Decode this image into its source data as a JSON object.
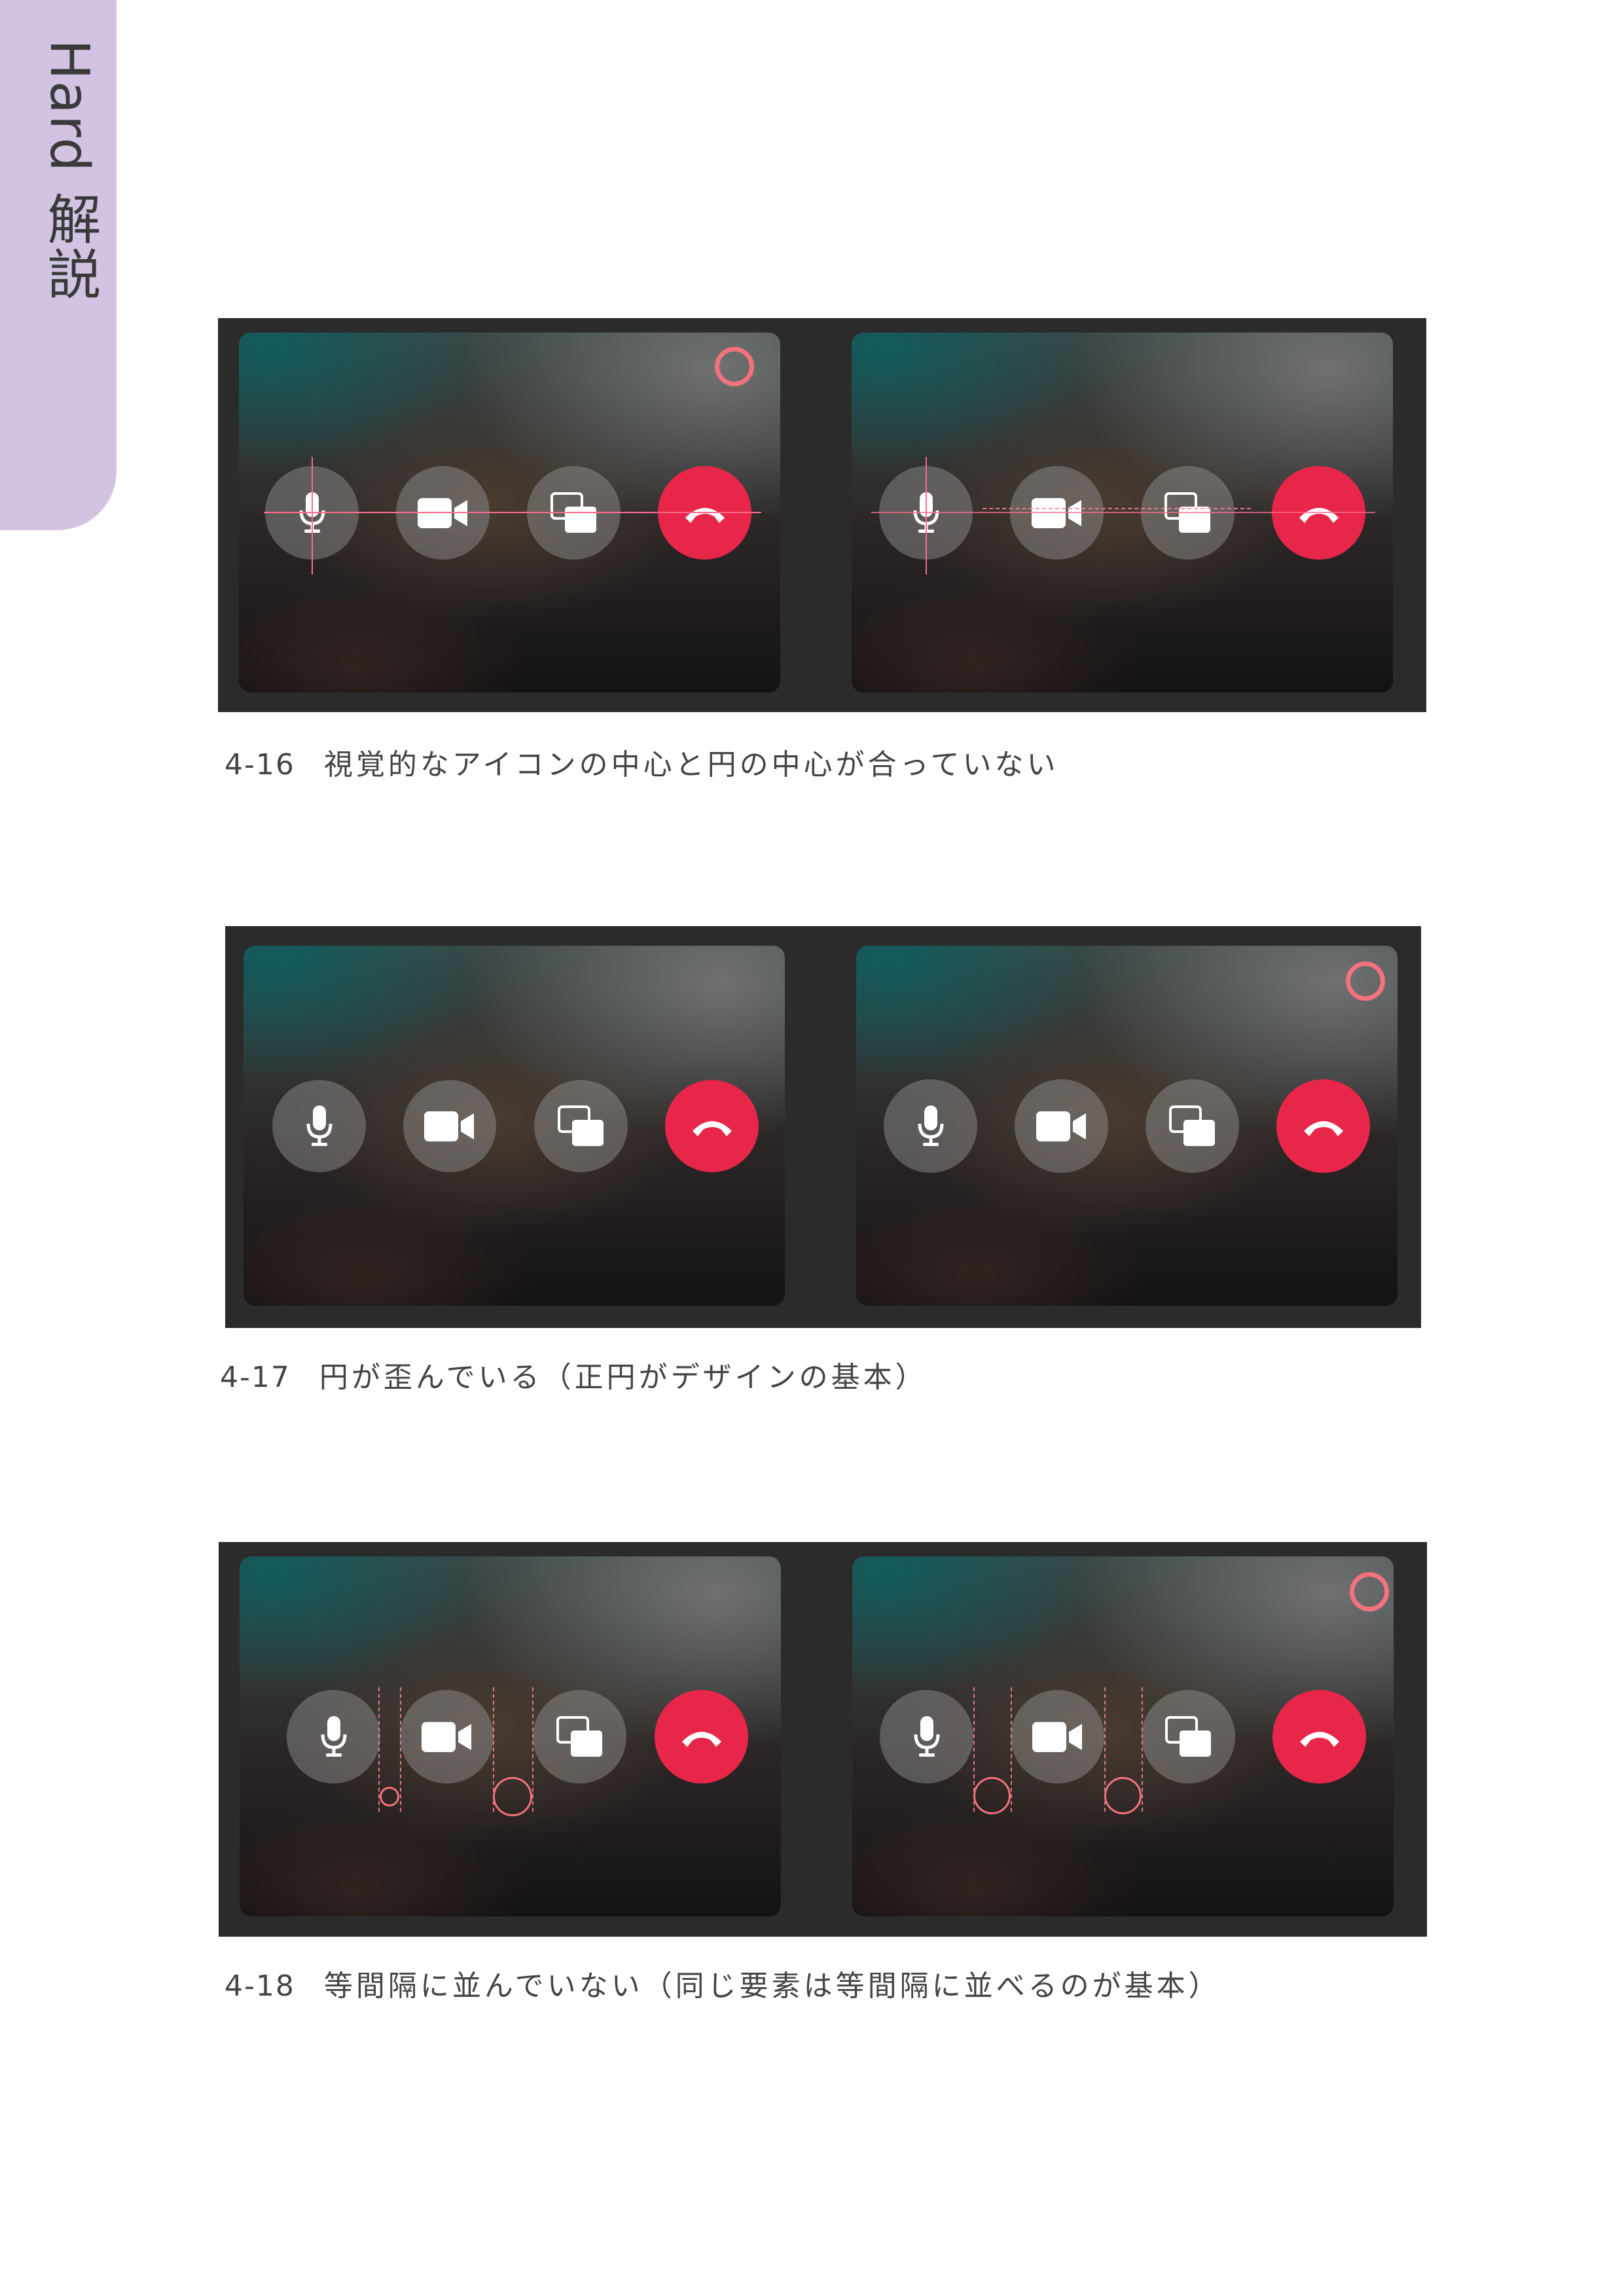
{
  "side_tab": {
    "text": "Hard 解説"
  },
  "figures": [
    {
      "number": "4-16",
      "caption": "視覚的なアイコンの中心と円の中心が合っていない"
    },
    {
      "number": "4-17",
      "caption": "円が歪んでいる（正円がデザインの基本）"
    },
    {
      "number": "4-18",
      "caption": "等間隔に並んでいない（同じ要素は等間隔に並べるのが基本）"
    }
  ],
  "call_controls": [
    {
      "name": "microphone",
      "icon": "mic-icon"
    },
    {
      "name": "camera",
      "icon": "video-icon"
    },
    {
      "name": "screen-share",
      "icon": "screen-share-icon"
    },
    {
      "name": "end-call",
      "icon": "hang-up-icon"
    }
  ],
  "colors": {
    "side_tab": "#d3c3e3",
    "end_call": "#e8264a",
    "marker": "#f2727d",
    "guide_line": "#ff6b8a",
    "figure_frame": "#2b2b2b"
  }
}
